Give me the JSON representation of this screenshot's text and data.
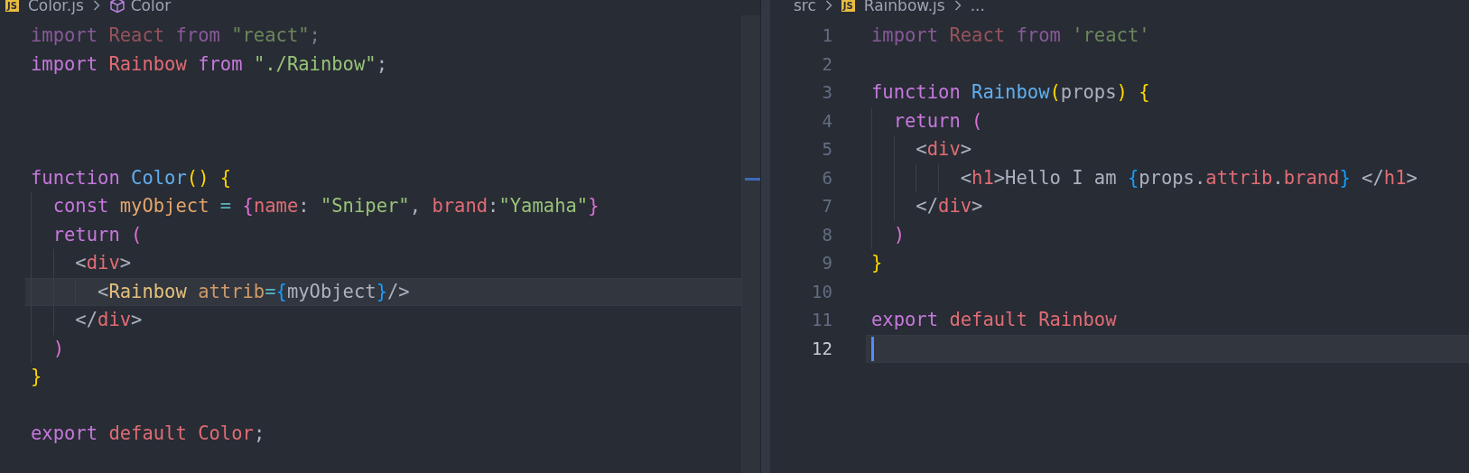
{
  "panes": [
    {
      "breadcrumbs": [
        {
          "kind": "file",
          "badge": "JS",
          "text": "Color.js"
        },
        {
          "kind": "symbol",
          "text": "Color"
        }
      ],
      "lines": [
        {
          "kind": "code",
          "dimmed": true,
          "current": false,
          "tokens": [
            {
              "kind": "keyword",
              "text": "import "
            },
            {
              "kind": "variable",
              "text": "React "
            },
            {
              "kind": "keyword",
              "text": "from "
            },
            {
              "kind": "string",
              "text": "\"react\""
            },
            {
              "kind": "plain",
              "text": ";"
            }
          ]
        },
        {
          "kind": "code",
          "dimmed": false,
          "current": false,
          "tokens": [
            {
              "kind": "keyword",
              "text": "import "
            },
            {
              "kind": "variable",
              "text": "Rainbow "
            },
            {
              "kind": "keyword",
              "text": "from "
            },
            {
              "kind": "string",
              "text": "\"./Rainbow\""
            },
            {
              "kind": "plain",
              "text": ";"
            }
          ]
        },
        {
          "kind": "blank",
          "current": false
        },
        {
          "kind": "blank",
          "current": false
        },
        {
          "kind": "blank",
          "current": false
        },
        {
          "kind": "code",
          "dimmed": false,
          "current": false,
          "tokens": [
            {
              "kind": "keyword",
              "text": "function "
            },
            {
              "kind": "function",
              "text": "Color"
            },
            {
              "kind": "bracket1",
              "text": "() {"
            }
          ]
        },
        {
          "kind": "code",
          "dimmed": false,
          "current": false,
          "tokens": [
            {
              "kind": "keyword",
              "text": "  const "
            },
            {
              "kind": "constant",
              "text": "myObject "
            },
            {
              "kind": "operator",
              "text": "= "
            },
            {
              "kind": "bracket2",
              "text": "{"
            },
            {
              "kind": "property",
              "text": "name"
            },
            {
              "kind": "plain",
              "text": ": "
            },
            {
              "kind": "string",
              "text": "\"Sniper\""
            },
            {
              "kind": "plain",
              "text": ", "
            },
            {
              "kind": "property",
              "text": "brand"
            },
            {
              "kind": "plain",
              "text": ":"
            },
            {
              "kind": "string",
              "text": "\"Yamaha\""
            },
            {
              "kind": "bracket2",
              "text": "}"
            }
          ]
        },
        {
          "kind": "code",
          "dimmed": false,
          "current": false,
          "tokens": [
            {
              "kind": "keyword",
              "text": "  return "
            },
            {
              "kind": "bracket2",
              "text": "("
            }
          ]
        },
        {
          "kind": "code",
          "dimmed": false,
          "current": false,
          "tokens": [
            {
              "kind": "plain",
              "text": "    <"
            },
            {
              "kind": "tag",
              "text": "div"
            },
            {
              "kind": "plain",
              "text": ">"
            }
          ]
        },
        {
          "kind": "code",
          "dimmed": false,
          "current": true,
          "tokens": [
            {
              "kind": "plain",
              "text": "      <"
            },
            {
              "kind": "component",
              "text": "Rainbow "
            },
            {
              "kind": "attribute",
              "text": "attrib"
            },
            {
              "kind": "operator",
              "text": "="
            },
            {
              "kind": "bracket3",
              "text": "{"
            },
            {
              "kind": "plain",
              "text": "myObject"
            },
            {
              "kind": "bracket3",
              "text": "}"
            },
            {
              "kind": "plain",
              "text": "/>"
            }
          ]
        },
        {
          "kind": "code",
          "dimmed": false,
          "current": false,
          "tokens": [
            {
              "kind": "plain",
              "text": "    </"
            },
            {
              "kind": "tag",
              "text": "div"
            },
            {
              "kind": "plain",
              "text": ">"
            }
          ]
        },
        {
          "kind": "code",
          "dimmed": false,
          "current": false,
          "tokens": [
            {
              "kind": "bracket2",
              "text": "  )"
            }
          ]
        },
        {
          "kind": "code",
          "dimmed": false,
          "current": false,
          "tokens": [
            {
              "kind": "bracket1",
              "text": "}"
            }
          ]
        },
        {
          "kind": "blank",
          "current": false
        },
        {
          "kind": "code",
          "dimmed": false,
          "current": false,
          "tokens": [
            {
              "kind": "keyword",
              "text": "export "
            },
            {
              "kind": "variable",
              "text": "default "
            },
            {
              "kind": "variable",
              "text": "Color"
            },
            {
              "kind": "plain",
              "text": ";"
            }
          ]
        }
      ]
    },
    {
      "breadcrumbs": [
        {
          "kind": "folder",
          "text": "src"
        },
        {
          "kind": "file",
          "badge": "JS",
          "text": "Rainbow.js"
        },
        {
          "kind": "more",
          "text": "..."
        }
      ],
      "lines": [
        {
          "kind": "code",
          "number": "1",
          "dimmed": true,
          "current": false,
          "tokens": [
            {
              "kind": "keyword",
              "text": "import "
            },
            {
              "kind": "variable",
              "text": "React "
            },
            {
              "kind": "keyword",
              "text": "from "
            },
            {
              "kind": "string",
              "text": "'react'"
            }
          ]
        },
        {
          "kind": "blank",
          "number": "2",
          "current": false
        },
        {
          "kind": "code",
          "number": "3",
          "dimmed": false,
          "current": false,
          "tokens": [
            {
              "kind": "keyword",
              "text": "function "
            },
            {
              "kind": "function",
              "text": "Rainbow"
            },
            {
              "kind": "bracket1",
              "text": "("
            },
            {
              "kind": "plain",
              "text": "props"
            },
            {
              "kind": "bracket1",
              "text": ") {"
            }
          ]
        },
        {
          "kind": "code",
          "number": "4",
          "dimmed": false,
          "current": false,
          "tokens": [
            {
              "kind": "keyword",
              "text": "  return "
            },
            {
              "kind": "bracket2",
              "text": "("
            }
          ]
        },
        {
          "kind": "code",
          "number": "5",
          "dimmed": false,
          "current": false,
          "tokens": [
            {
              "kind": "plain",
              "text": "    <"
            },
            {
              "kind": "tag",
              "text": "div"
            },
            {
              "kind": "plain",
              "text": ">"
            }
          ]
        },
        {
          "kind": "code",
          "number": "6",
          "dimmed": false,
          "current": false,
          "tokens": [
            {
              "kind": "plain",
              "text": "        <"
            },
            {
              "kind": "tag",
              "text": "h1"
            },
            {
              "kind": "plain",
              "text": ">Hello I am "
            },
            {
              "kind": "bracket3",
              "text": "{"
            },
            {
              "kind": "plain",
              "text": "props."
            },
            {
              "kind": "property",
              "text": "attrib"
            },
            {
              "kind": "plain",
              "text": "."
            },
            {
              "kind": "property",
              "text": "brand"
            },
            {
              "kind": "bracket3",
              "text": "}"
            },
            {
              "kind": "plain",
              "text": " </"
            },
            {
              "kind": "tag",
              "text": "h1"
            },
            {
              "kind": "plain",
              "text": ">"
            }
          ]
        },
        {
          "kind": "code",
          "number": "7",
          "dimmed": false,
          "current": false,
          "tokens": [
            {
              "kind": "plain",
              "text": "    </"
            },
            {
              "kind": "tag",
              "text": "div"
            },
            {
              "kind": "plain",
              "text": ">"
            }
          ]
        },
        {
          "kind": "code",
          "number": "8",
          "dimmed": false,
          "current": false,
          "tokens": [
            {
              "kind": "bracket2",
              "text": "  )"
            }
          ]
        },
        {
          "kind": "code",
          "number": "9",
          "dimmed": false,
          "current": false,
          "tokens": [
            {
              "kind": "bracket1",
              "text": "}"
            }
          ]
        },
        {
          "kind": "blank",
          "number": "10",
          "current": false
        },
        {
          "kind": "code",
          "number": "11",
          "dimmed": false,
          "current": false,
          "tokens": [
            {
              "kind": "keyword",
              "text": "export "
            },
            {
              "kind": "variable",
              "text": "default "
            },
            {
              "kind": "variable",
              "text": "Rainbow"
            }
          ]
        },
        {
          "kind": "blank",
          "number": "12",
          "current": true,
          "cursor": true
        }
      ]
    }
  ]
}
